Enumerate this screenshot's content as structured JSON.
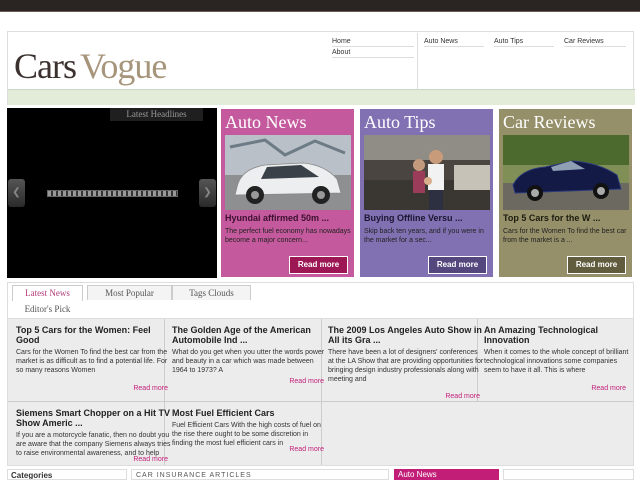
{
  "header": {
    "logo_part1": "Cars",
    "logo_part2": "Vogue",
    "nav_left": [
      "Home",
      "About"
    ],
    "nav_right": [
      "Auto News",
      "Auto Tips",
      "Car Reviews"
    ]
  },
  "slider": {
    "tab_label": "Latest Headlines",
    "prev_icon": "chevron-left-icon",
    "next_icon": "chevron-right-icon"
  },
  "cards": [
    {
      "title": "Auto News",
      "headline": "Hyundai affirmed 50m ...",
      "desc": "The perfect fuel economy has nowadays become a major concern...",
      "button": "Read more",
      "color": "#c45a9d"
    },
    {
      "title": "Auto Tips",
      "headline": "Buying Offline Versu ...",
      "desc": "Skip back ten years, and if you were in the market for a sec...",
      "button": "Read more",
      "color": "#8171b2"
    },
    {
      "title": "Car Reviews",
      "headline": "Top 5 Cars for the W ...",
      "desc": "Cars for the Women To find the best car from the market is a ...",
      "button": "Read more",
      "color": "#959069"
    }
  ],
  "tabs": {
    "items": [
      "Latest News",
      "Most Popular",
      "Tags Clouds"
    ],
    "second_row": "Editor's Pick",
    "active": "Latest News"
  },
  "articles": [
    {
      "title": "Top 5 Cars for the Women: Feel Good",
      "desc": "Cars for the Women To find the best car from the market is as difficult as to find a potential life. For so many reasons Women",
      "more": "Read more"
    },
    {
      "title": "The Golden Age of the American Automobile Ind ...",
      "desc": "What do you get when you utter the words power and beauty in a car which was made between 1964 to 1973? A",
      "more": "Read more"
    },
    {
      "title": "The 2009 Los Angeles Auto Show in All its Gra ...",
      "desc": "There have been a lot of designers' conferences at the LA Show that are providing opportunities for bringing design industry professionals along with meeting and",
      "more": "Read more"
    },
    {
      "title": "An Amazing Technological Innovation",
      "desc": "When it comes to the whole concept of brilliant technological innovations some companies seem to have it all. This is where",
      "more": "Read more"
    },
    {
      "title": "Siemens Smart Chopper on a Hit TV Show Americ ...",
      "desc": "If you are a motorcycle fanatic, then no doubt you are aware that the company Siemens always tries to raise environmental awareness, and to help",
      "more": "Read more"
    },
    {
      "title": "Most Fuel Efficient Cars",
      "desc": "Fuel Efficient Cars With the high costs of fuel on the rise there ought to be some discretion in finding the most fuel efficient cars in",
      "more": "Read more"
    }
  ],
  "bottom": {
    "categories": "Categories",
    "insurance": "CAR INSURANCE ARTICLES",
    "auto_news": "Auto News"
  }
}
